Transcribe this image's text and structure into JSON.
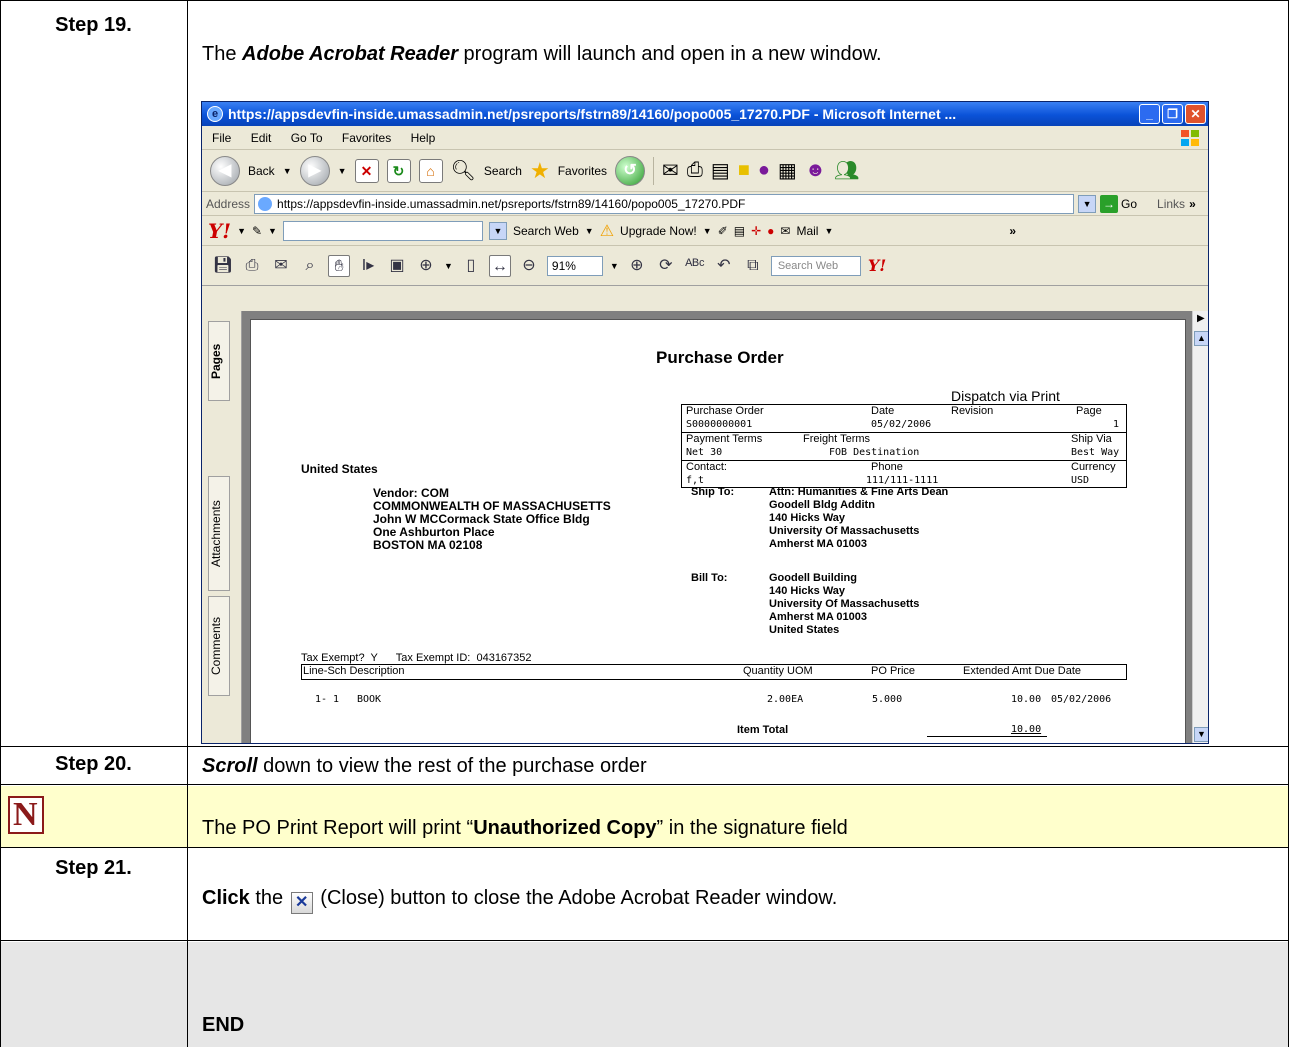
{
  "steps": [
    {
      "label": "Step 19.",
      "text_plain": "The ",
      "text_em": "Adobe Acrobat Reader",
      "text_rest": " program will launch and open in a new window."
    },
    {
      "label": "Step 20.",
      "text_em": "Scroll",
      "text_rest": " down to view the rest of the purchase order"
    },
    {
      "label": "Step 21.",
      "text_bold": "Click",
      "text_mid": " the ",
      "text_rest": " (Close) button to close the Adobe Acrobat Reader window."
    }
  ],
  "note": {
    "pre": "The PO Print Report will print “",
    "bold": "Unauthorized Copy",
    "post": "” in the signature field"
  },
  "end_label": "END",
  "browser": {
    "title": "https://appsdevfin-inside.umassadmin.net/psreports/fstrn89/14160/popo005_17270.PDF - Microsoft Internet ...",
    "menu": [
      "File",
      "Edit",
      "Go To",
      "Favorites",
      "Help"
    ],
    "toolbar": {
      "back": "Back",
      "search": "Search",
      "favorites": "Favorites"
    },
    "address_label": "Address",
    "address_value": "https://appsdevfin-inside.umassadmin.net/psreports/fstrn89/14160/popo005_17270.PDF",
    "go": "Go",
    "links": "Links",
    "yahoo": {
      "search_web": "Search Web",
      "upgrade": "Upgrade Now!",
      "mail": "Mail"
    },
    "acrobat": {
      "zoom": "91%",
      "search_web": "Search Web"
    },
    "side_tabs": [
      "Pages",
      "Attachments",
      "Comments"
    ]
  },
  "po": {
    "title": "Purchase Order",
    "dispatch": "Dispatch via Print",
    "hdr": {
      "po_label": "Purchase Order",
      "date_label": "Date",
      "revision_label": "Revision",
      "page_label": "Page",
      "po_value": "S0000000001",
      "date_value": "05/02/2006",
      "page_value": "1",
      "terms_label": "Payment Terms",
      "freight_label": "Freight Terms",
      "shipvia_label": "Ship Via",
      "terms_value": "Net 30",
      "freight_value": "FOB Destination",
      "shipvia_value": "Best Way",
      "contact_label": "Contact:",
      "phone_label": "Phone",
      "currency_label": "Currency",
      "contact_value": "f,t",
      "phone_value": "111/111-1111",
      "currency_value": "USD"
    },
    "country": "United States",
    "vendor": [
      "Vendor:  COM",
      "COMMONWEALTH OF MASSACHUSETTS",
      "John W MCCormack State Office Bldg",
      "One Ashburton Place",
      "BOSTON MA 02108"
    ],
    "ship_to_label": "Ship To:",
    "ship_to": [
      "Attn: Humanities & Fine Arts Dean",
      "Goodell Bldg Additn",
      "140 Hicks Way",
      "University Of Massachusetts",
      "Amherst MA 01003"
    ],
    "bill_to_label": "Bill To:",
    "bill_to": [
      "Goodell Building",
      "140 Hicks Way",
      "University Of Massachusetts",
      "Amherst MA 01003",
      "United States"
    ],
    "tax": "Tax Exempt?  Y      Tax Exempt ID:  043167352",
    "cols": {
      "line": "Line-Sch  Description",
      "qty": "Quantity UOM",
      "price": "PO Price",
      "ext": "Extended Amt  Due Date"
    },
    "line": {
      "num": "1- 1",
      "desc": "BOOK",
      "qty": "2.00EA",
      "price": "5.000",
      "ext": "10.00",
      "due": "05/02/2006"
    },
    "item_total_label": "Item Total",
    "item_total": "10.00"
  }
}
